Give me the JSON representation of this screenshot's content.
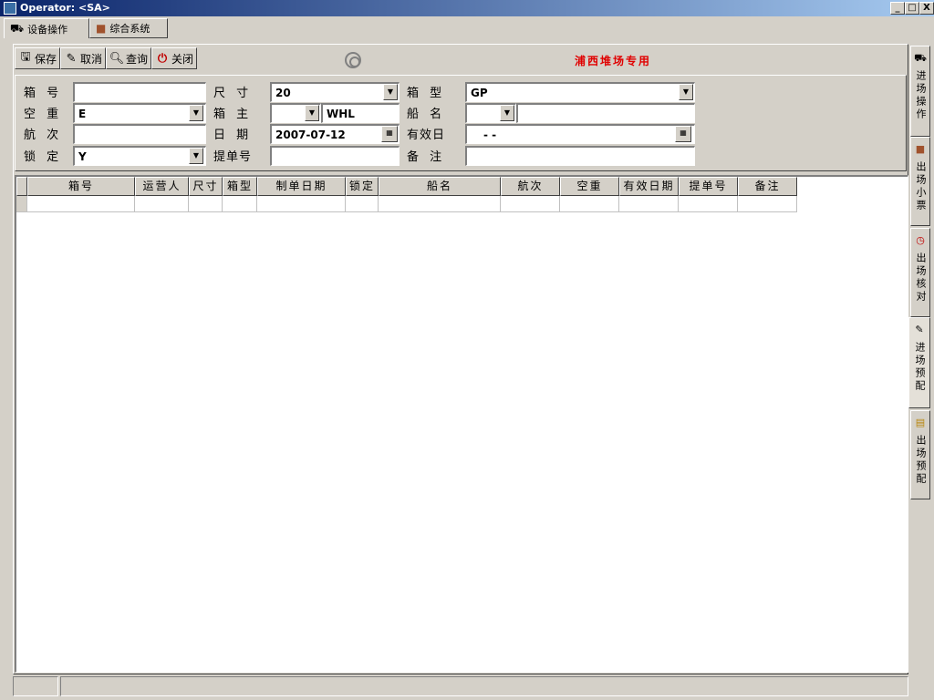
{
  "window": {
    "title": "Operator: <SA>",
    "controls": {
      "minimize": "_",
      "maximize": "□",
      "close": "X"
    }
  },
  "module_tabs": [
    {
      "label": "设备操作",
      "icon": "device-icon"
    },
    {
      "label": "综合系统",
      "icon": "cube-icon"
    }
  ],
  "toolbar": {
    "save": "保存",
    "cancel": "取消",
    "query": "查询",
    "close": "关闭",
    "banner": "浦西堆场专用"
  },
  "form": {
    "box_no": {
      "label": "箱 号",
      "value": ""
    },
    "empty_heavy": {
      "label": "空 重",
      "value": "E"
    },
    "voyage": {
      "label": "航 次",
      "value": ""
    },
    "locked": {
      "label": "锁 定",
      "value": "Y"
    },
    "size": {
      "label": "尺 寸",
      "value": "20"
    },
    "owner": {
      "label": "箱 主",
      "code": "",
      "value": "WHL"
    },
    "date": {
      "label": "日 期",
      "value": "2007-07-12"
    },
    "bill_no": {
      "label": "提单号",
      "value": ""
    },
    "box_type": {
      "label": "箱 型",
      "value": "GP"
    },
    "ship_name": {
      "label": "船 名",
      "code": "",
      "value": ""
    },
    "valid_date": {
      "label": "有效日",
      "value": " - -"
    },
    "remark": {
      "label": "备 注",
      "value": ""
    }
  },
  "grid": {
    "columns": [
      "箱号",
      "运营人",
      "尺寸",
      "箱型",
      "制单日期",
      "锁定",
      "船名",
      "航次",
      "空重",
      "有效日期",
      "提单号",
      "备注"
    ]
  },
  "side_tabs": [
    {
      "label": "进场操作",
      "icon": "truck-icon"
    },
    {
      "label": "出场小票",
      "icon": "cube-icon"
    },
    {
      "label": "出场核对",
      "icon": "clock-icon"
    },
    {
      "label": "进场预配",
      "icon": "edit-icon"
    },
    {
      "label": "出场预配",
      "icon": "note-icon"
    }
  ]
}
